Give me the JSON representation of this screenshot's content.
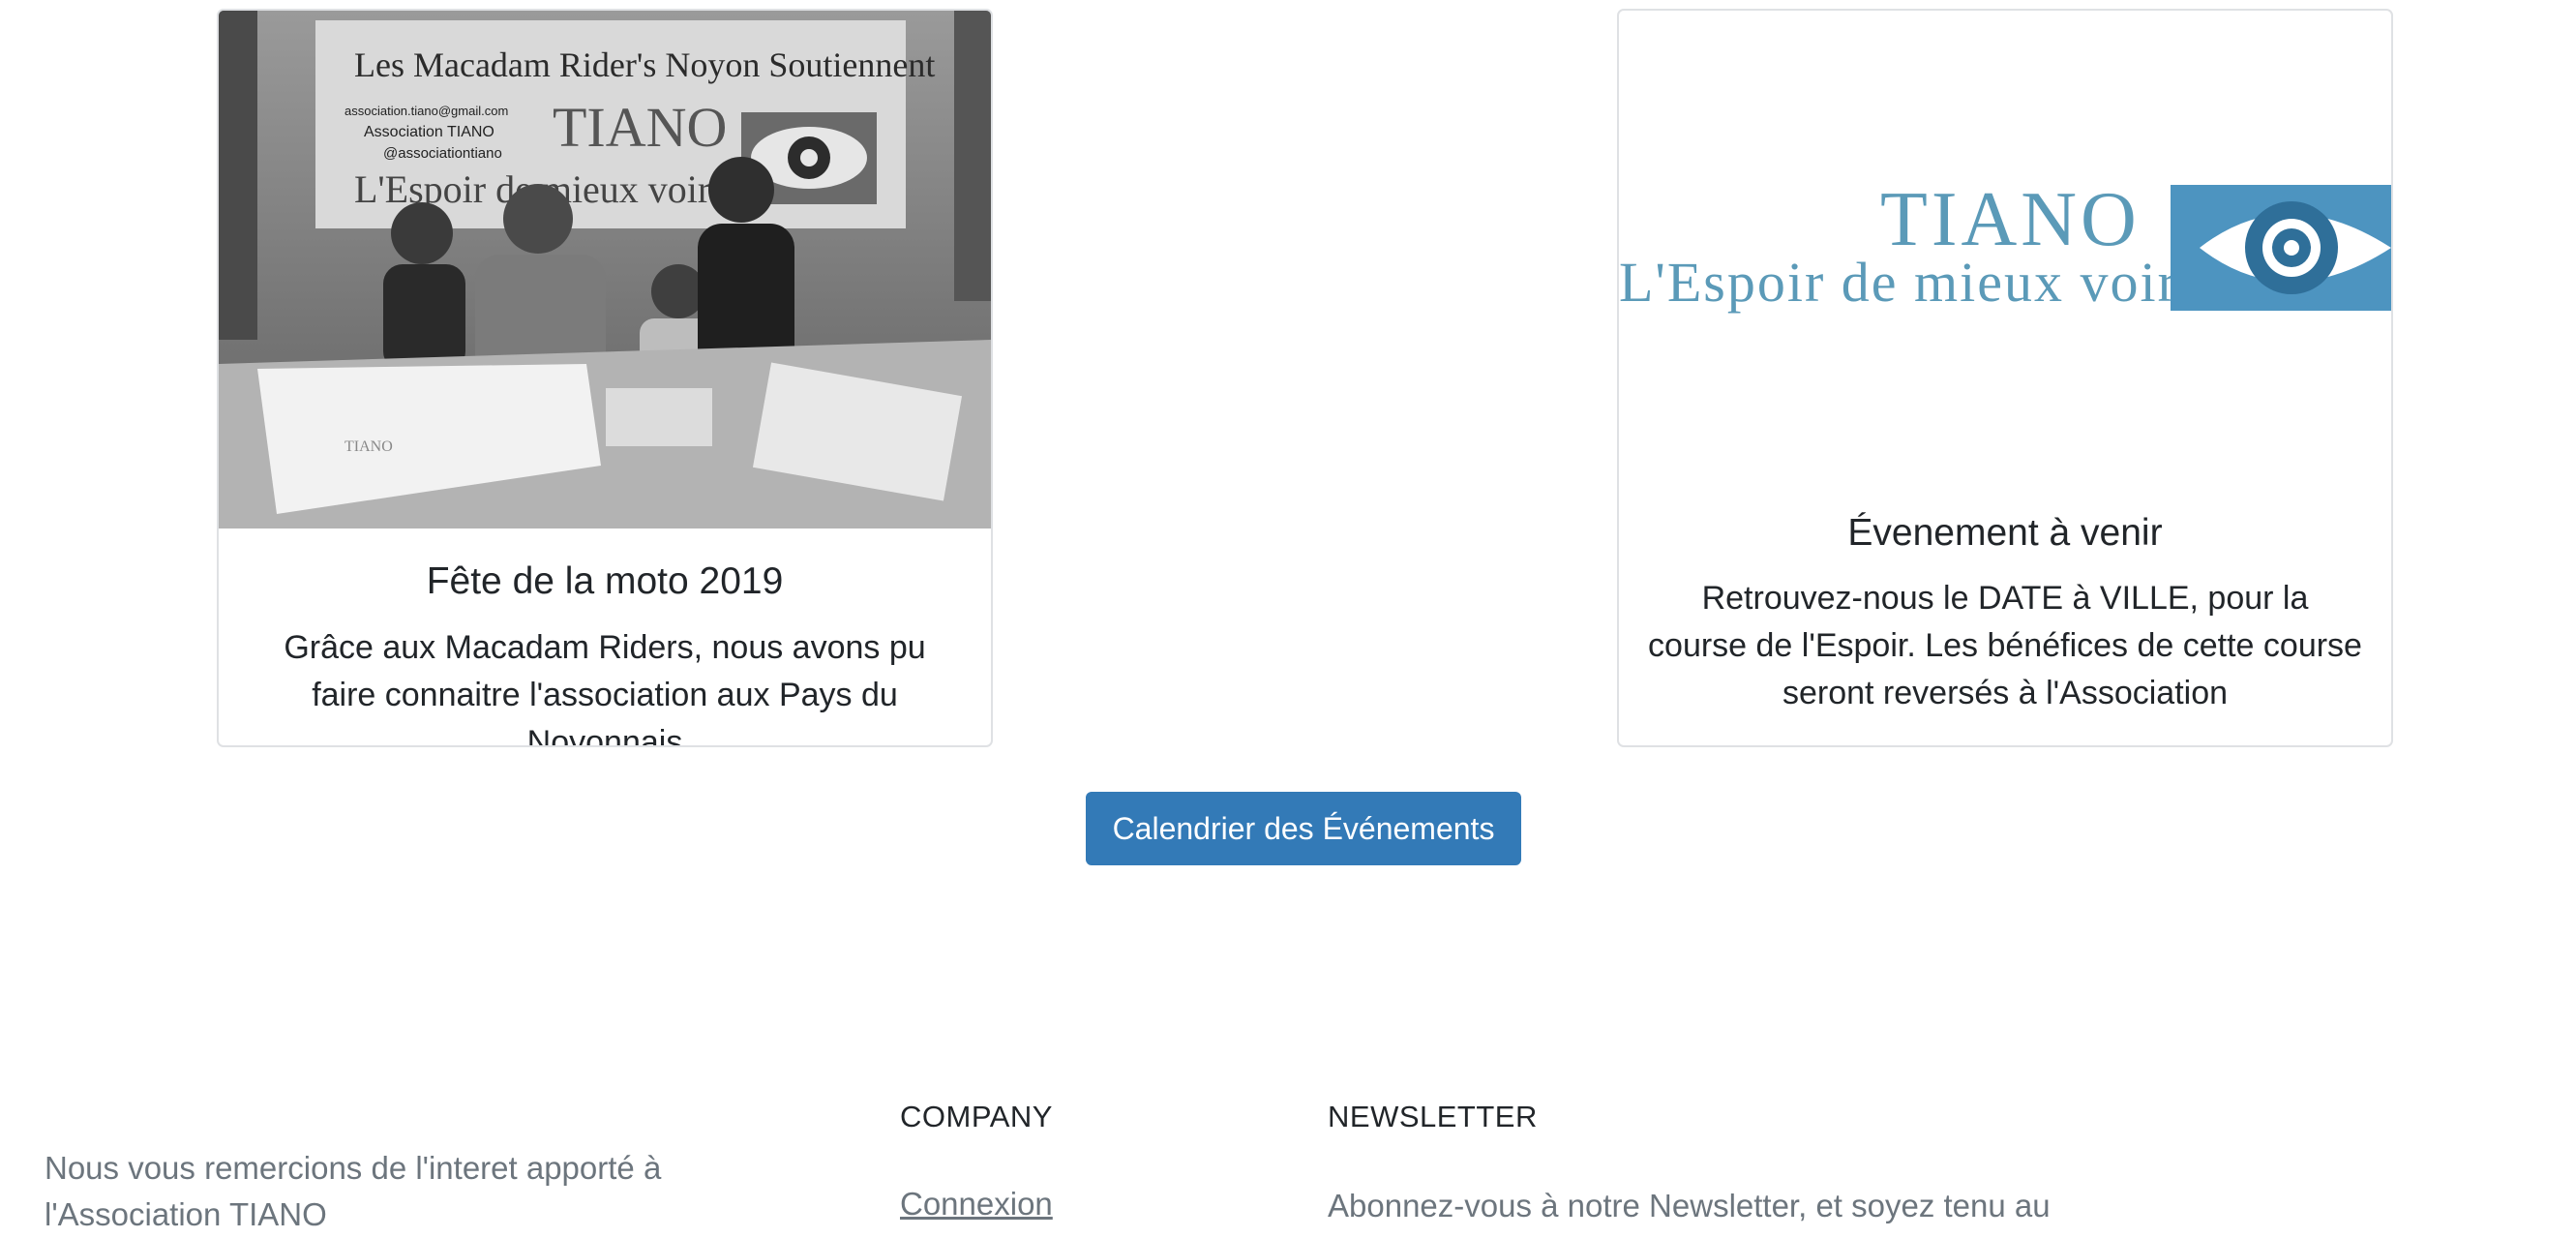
{
  "events": {
    "left_card": {
      "title": "Fête de la moto 2019",
      "text": "Grâce aux Macadam Riders, nous avons pu faire connaitre l'association aux Pays du Noyonnais",
      "photo": {
        "banner_line1": "Les Macadam Rider's Noyon Soutiennent",
        "email": "association.tiano@gmail.com",
        "facebook": "Association TIANO",
        "instagram": "@associationtiano",
        "brand": "TIANO",
        "slogan": "L'Espoir de mieux voir"
      }
    },
    "right_card": {
      "logo_name": "TIANO",
      "logo_slogan": "L'Espoir de mieux voir",
      "title": "Évenement à venir",
      "text": "Retrouvez-nous le DATE à VILLE, pour la course de l'Espoir. Les bénéfices de cette course seront reversés à l'Association"
    },
    "calendar_button": "Calendrier des Événements"
  },
  "footer": {
    "thanks": "Nous vous remercions de l'interet apporté à l'Association TIANO",
    "company_heading": "COMPANY",
    "login_link": "Connexion",
    "newsletter_heading": "NEWSLETTER",
    "newsletter_text": "Abonnez-vous à notre Newsletter, et soyez tenu au"
  },
  "colors": {
    "button": "#337ab7",
    "logo_text": "#5b9ab8",
    "logo_eye_box": "#4d94c0",
    "muted_text": "#6c757d"
  }
}
